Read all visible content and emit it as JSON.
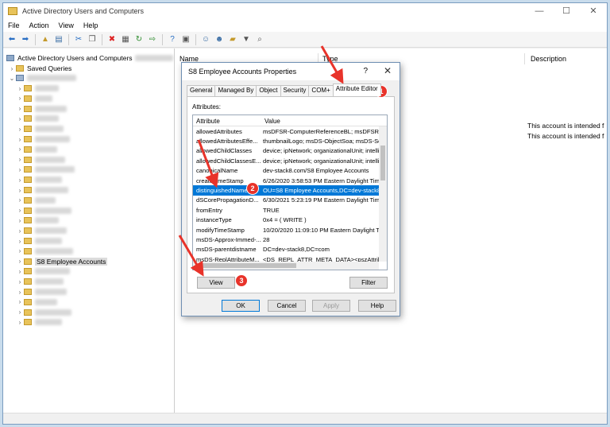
{
  "window": {
    "title": "Active Directory Users and Computers",
    "controls": [
      "—",
      "☐",
      "✕"
    ]
  },
  "menu": [
    "File",
    "Action",
    "View",
    "Help"
  ],
  "tree": {
    "root": "Active Directory Users and Computers",
    "saved_queries": "Saved Queries",
    "selected_ou": "S8 Employee Accounts"
  },
  "right_pane": {
    "columns": [
      "Name",
      "Type",
      "Description"
    ],
    "descriptions": [
      "This account is intended f",
      "This account is intended f"
    ]
  },
  "dialog": {
    "title": "S8 Employee Accounts Properties",
    "help": "?",
    "close": "✕",
    "tabs": [
      "General",
      "Managed By",
      "Object",
      "Security",
      "COM+",
      "Attribute Editor"
    ],
    "attributes_label": "Attributes:",
    "list_headers": [
      "Attribute",
      "Value"
    ],
    "rows": [
      {
        "attr": "allowedAttributes",
        "value": "msDFSR-ComputerReferenceBL; msDFSR-M"
      },
      {
        "attr": "allowedAttributesEffe...",
        "value": "thumbnailLogo; msDS-ObjectSoa; msDS-Sou"
      },
      {
        "attr": "allowedChildClasses",
        "value": "device; ipNetwork; organizationalUnit; intellim"
      },
      {
        "attr": "allowedChildClassesE...",
        "value": "device; ipNetwork; organizationalUnit; intellim"
      },
      {
        "attr": "canonicalName",
        "value": "dev-stack8.com/S8 Employee Accounts"
      },
      {
        "attr": "createTimeStamp",
        "value": "6/26/2020 3:58:53 PM Eastern Daylight Tim"
      },
      {
        "attr": "distinguishedName",
        "value": "OU=S8 Employee Accounts,DC=dev-stack8,",
        "selected": true
      },
      {
        "attr": "dSCorePropagationD...",
        "value": "6/30/2021 5:23:19 PM Eastern Daylight Tim"
      },
      {
        "attr": "fromEntry",
        "value": "TRUE"
      },
      {
        "attr": "instanceType",
        "value": "0x4 = ( WRITE )"
      },
      {
        "attr": "modifyTimeStamp",
        "value": "10/20/2020 11:09:10 PM Eastern Daylight T"
      },
      {
        "attr": "msDS-Approx-Immed-...",
        "value": "28"
      },
      {
        "attr": "msDS-parentdistname",
        "value": "DC=dev-stack8,DC=com"
      },
      {
        "attr": "msDS-ReplAttributeM...",
        "value": "<DS_REPL_ATTR_META_DATA><pszAttrib"
      }
    ],
    "view_button": "View",
    "filter_button": "Filter",
    "ok_button": "OK",
    "cancel_button": "Cancel",
    "apply_button": "Apply",
    "help_button": "Help"
  },
  "annotations": [
    "1",
    "2",
    "3"
  ],
  "colors": {
    "marker": "#e8332a",
    "selection": "#0078d7"
  }
}
